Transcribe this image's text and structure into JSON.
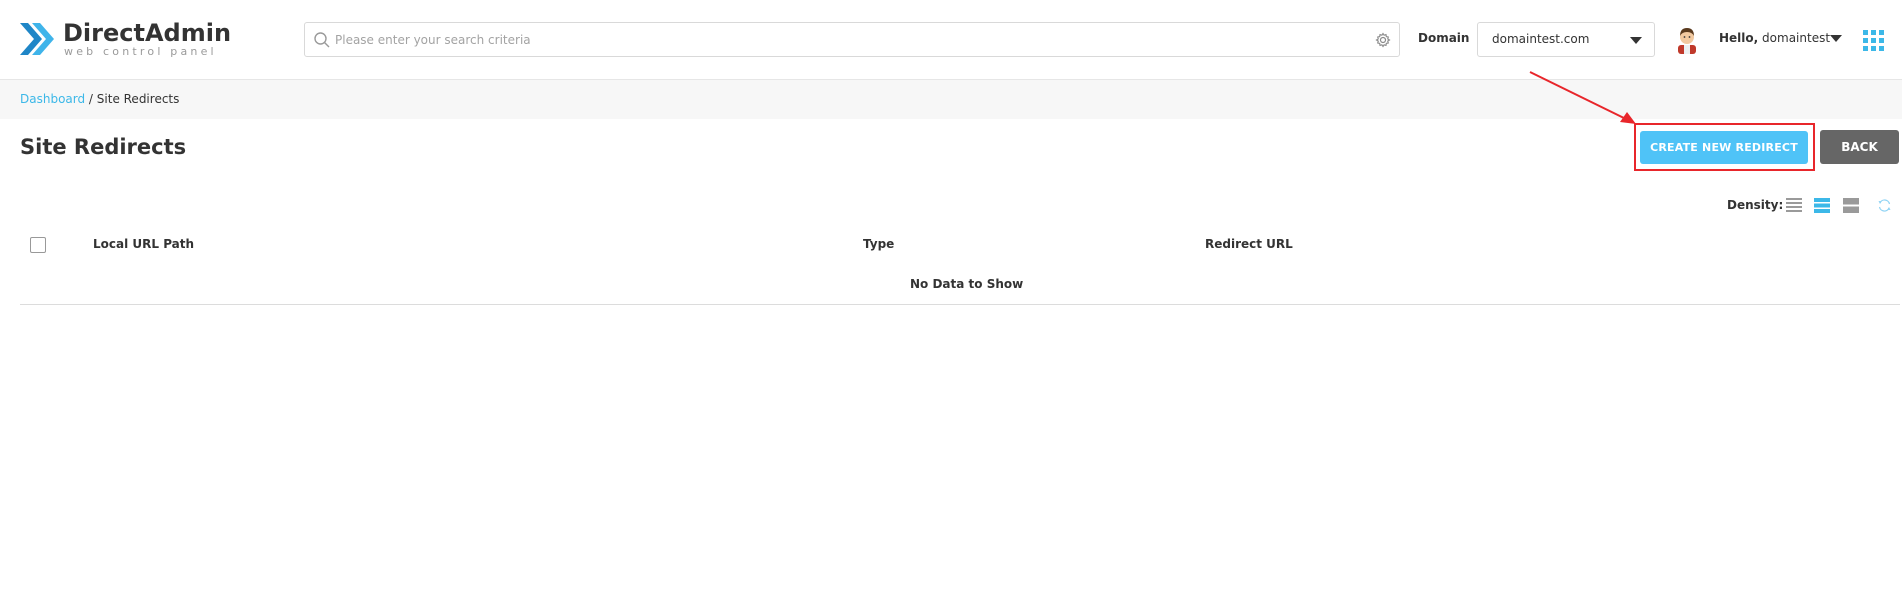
{
  "header": {
    "logo_title": "DirectAdmin",
    "logo_subtitle": "web control panel",
    "search_placeholder": "Please enter your search criteria",
    "domain_label": "Domain",
    "domain_value": "domaintest.com",
    "greeting": "Hello,",
    "username": "domaintest"
  },
  "breadcrumb": {
    "root": "Dashboard",
    "separator": " / ",
    "current": "Site Redirects"
  },
  "page": {
    "title": "Site Redirects",
    "create_button": "CREATE NEW REDIRECT",
    "back_button": "BACK"
  },
  "table": {
    "density_label": "Density:",
    "columns": [
      "Local URL Path",
      "Type",
      "Redirect URL"
    ],
    "empty_message": "No Data to Show"
  },
  "colors": {
    "accent": "#4fc3f7",
    "link": "#3cb8e8",
    "back_button": "#666666",
    "highlight": "#e8262b"
  },
  "icons": [
    "search-icon",
    "gear-icon",
    "chevron-down-icon",
    "avatar",
    "apps-grid-icon",
    "density-icon",
    "refresh-icon"
  ]
}
